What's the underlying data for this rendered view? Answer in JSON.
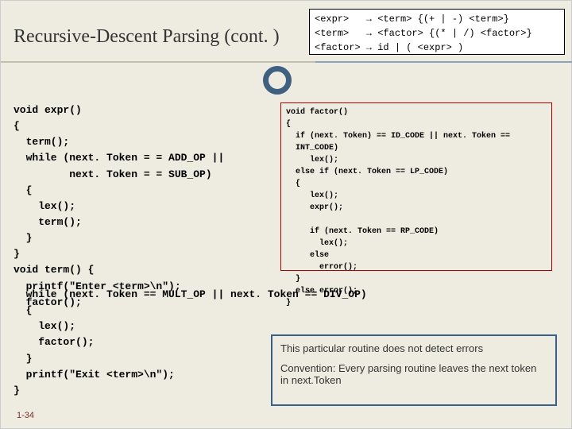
{
  "title": "Recursive-Descent Parsing (cont. )",
  "grammar": "<expr>   → <term> {(+ | -) <term>}\n<term>   → <factor> {(* | /) <factor>}\n<factor> → id | ( <expr> )",
  "code_left": "void expr()\n{\n  term();\n  while (next. Token = = ADD_OP ||\n         next. Token = = SUB_OP)\n  {\n    lex();\n    term();\n  }\n}\nvoid term() {\n  printf(\"Enter <term>\\n\");\n  factor();",
  "code_bottom": "  while (next. Token == MULT_OP || next. Token == DIV_OP)\n  {\n    lex();\n    factor();\n  }\n  printf(\"Exit <term>\\n\");\n}",
  "factor_code": "void factor()\n{\n  if (next. Token) == ID_CODE || next. Token ==\n  INT_CODE)\n     lex();\n  else if (next. Token == LP_CODE)\n  {\n     lex();\n     expr();\n\n     if (next. Token == RP_CODE)\n       lex();\n     else\n       error();\n  }\n  else error();\n}",
  "note_line1": "This particular routine does not detect errors",
  "note_line2": "Convention: Every parsing routine leaves the next token in next.Token",
  "page_number": "1-34"
}
